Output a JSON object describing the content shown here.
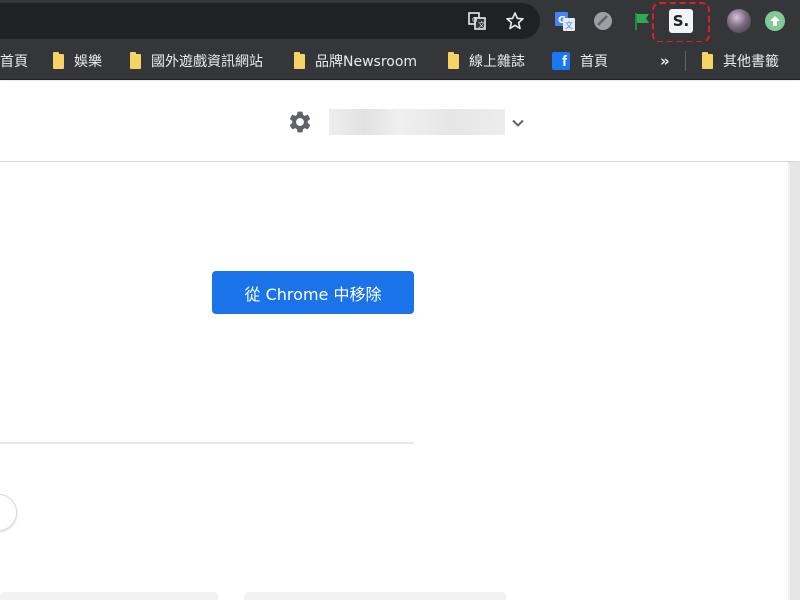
{
  "toolbar": {
    "icons": {
      "translate": "translate-icon",
      "bookmark_star": "star-icon",
      "ext_google_translate": "google-translate-extension-icon",
      "ext_gray": "gray-circle-extension-icon",
      "ext_flag": "green-flag-extension-icon",
      "ext_highlighted_letter": "S.",
      "profile": "avatar",
      "update": "update-arrow-icon"
    },
    "highlight_color": "#e81c1c"
  },
  "bookmarks": {
    "items": [
      {
        "label": "首頁",
        "icon": "none"
      },
      {
        "label": "娛樂",
        "icon": "folder-icon"
      },
      {
        "label": "國外遊戲資訊網站",
        "icon": "folder-icon"
      },
      {
        "label": "品牌Newsroom",
        "icon": "folder-icon"
      },
      {
        "label": "線上雜誌",
        "icon": "folder-icon"
      },
      {
        "label": "首頁",
        "icon": "facebook-icon"
      }
    ],
    "overflow": "»",
    "other": "其他書籤"
  },
  "page": {
    "settings_icon": "gear-icon",
    "dropdown_icon": "chevron-down-icon",
    "remove_button": "從 Chrome 中移除",
    "accent": "#1a73e8"
  }
}
